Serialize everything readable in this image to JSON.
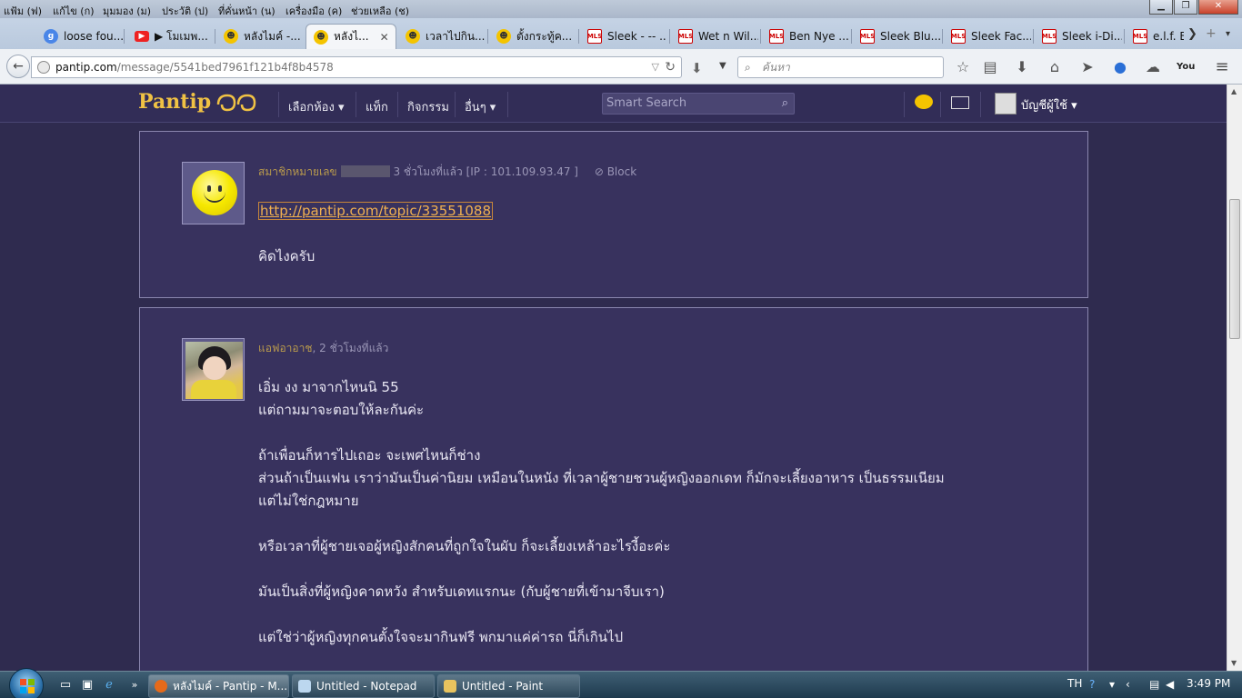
{
  "menubar": {
    "items": [
      "แฟ้ม (ฟ)",
      "แก้ไข (ก)",
      "มุมมอง (ม)",
      "ประวัติ (ป)",
      "ที่คั่นหน้า (น)",
      "เครื่องมือ (ค)",
      "ช่วยเหลือ (ช)"
    ]
  },
  "window_buttons": {
    "minimize": "▁",
    "maximize": "❐",
    "close": "✕"
  },
  "tabs": [
    {
      "label": "loose fou...",
      "icon": "google-icon"
    },
    {
      "label": "▶ โมเมพ...",
      "icon": "youtube-icon"
    },
    {
      "label": "หลังไมค์ -...",
      "icon": "pantip-icon"
    },
    {
      "label": "หลังไ...",
      "icon": "pantip-icon",
      "active": true
    },
    {
      "label": "เวลาไปกิน...",
      "icon": "pantip-icon"
    },
    {
      "label": "ตั้งกระทู้ค...",
      "icon": "pantip-icon"
    },
    {
      "label": "Sleek - -- ...",
      "icon": "mls-icon"
    },
    {
      "label": "Wet n Wil...",
      "icon": "mls-icon"
    },
    {
      "label": "Ben Nye ...",
      "icon": "mls-icon"
    },
    {
      "label": "Sleek Blu...",
      "icon": "mls-icon"
    },
    {
      "label": "Sleek Fac...",
      "icon": "mls-icon"
    },
    {
      "label": "Sleek i-Di...",
      "icon": "mls-icon"
    },
    {
      "label": "e.l.f. E",
      "icon": "mls-icon"
    }
  ],
  "tab_close": "✕",
  "navbar": {
    "url_host": "pantip.com",
    "url_path": "/message/5541bed7961f121b4f8b4578",
    "search_placeholder": "ค้นหา"
  },
  "pantip": {
    "logo": "Pantip",
    "nav": [
      "เลือกห้อง ▾",
      "แท็ก",
      "กิจกรรม",
      "อื่นๆ ▾"
    ],
    "smart_search_placeholder": "Smart Search",
    "account": "บัญชีผู้ใช้ ▾"
  },
  "posts": [
    {
      "author": "สมาชิกหมายเลข",
      "time": "3 ชั่วโมงที่แล้ว [IP : 101.109.93.47 ]",
      "block": "Block",
      "link": "http://pantip.com/topic/33551088",
      "lines": [
        "คิดไงครับ"
      ]
    },
    {
      "author": "แอฟอาอาช",
      "time": ", 2 ชั่วโมงที่แล้ว",
      "lines": [
        "เอิ่ม งง มาจากไหนนิ 55",
        "แต่ถามมาจะตอบให้ละกันค่ะ",
        "",
        "ถ้าเพื่อนก็หารไปเถอะ จะเพศไหนก็ช่าง",
        "ส่วนถ้าเป็นแฟน เราว่ามันเป็นค่านิยม เหมือนในหนัง ที่เวลาผู้ชายชวนผู้หญิงออกเดท ก็มักจะเลี้ยงอาหาร เป็นธรรมเนียม",
        "แต่ไม่ใช่กฎหมาย",
        "",
        "หรือเวลาที่ผู้ชายเจอผู้หญิงสักคนที่ถูกใจในผับ ก็จะเลี้ยงเหล้าอะไรงี้อะค่ะ",
        "",
        "มันเป็นสิ่งที่ผู้หญิงคาดหวัง สำหรับเดทแรกนะ (กับผู้ชายที่เข้ามาจีบเรา)",
        "",
        "แต่ใช่ว่าผู้หญิงทุกคนตั้งใจจะมากินฟรี พกมาแค่ค่ารถ นี่ก็เกินไป"
      ]
    }
  ],
  "taskbar": {
    "tasks": [
      {
        "label": "หลังไมค์ - Pantip - M...",
        "icon": "firefox-icon"
      },
      {
        "label": "Untitled - Notepad",
        "icon": "notepad-icon"
      },
      {
        "label": "Untitled - Paint",
        "icon": "paint-icon"
      }
    ],
    "lang": "TH",
    "clock": "3:49 PM"
  }
}
